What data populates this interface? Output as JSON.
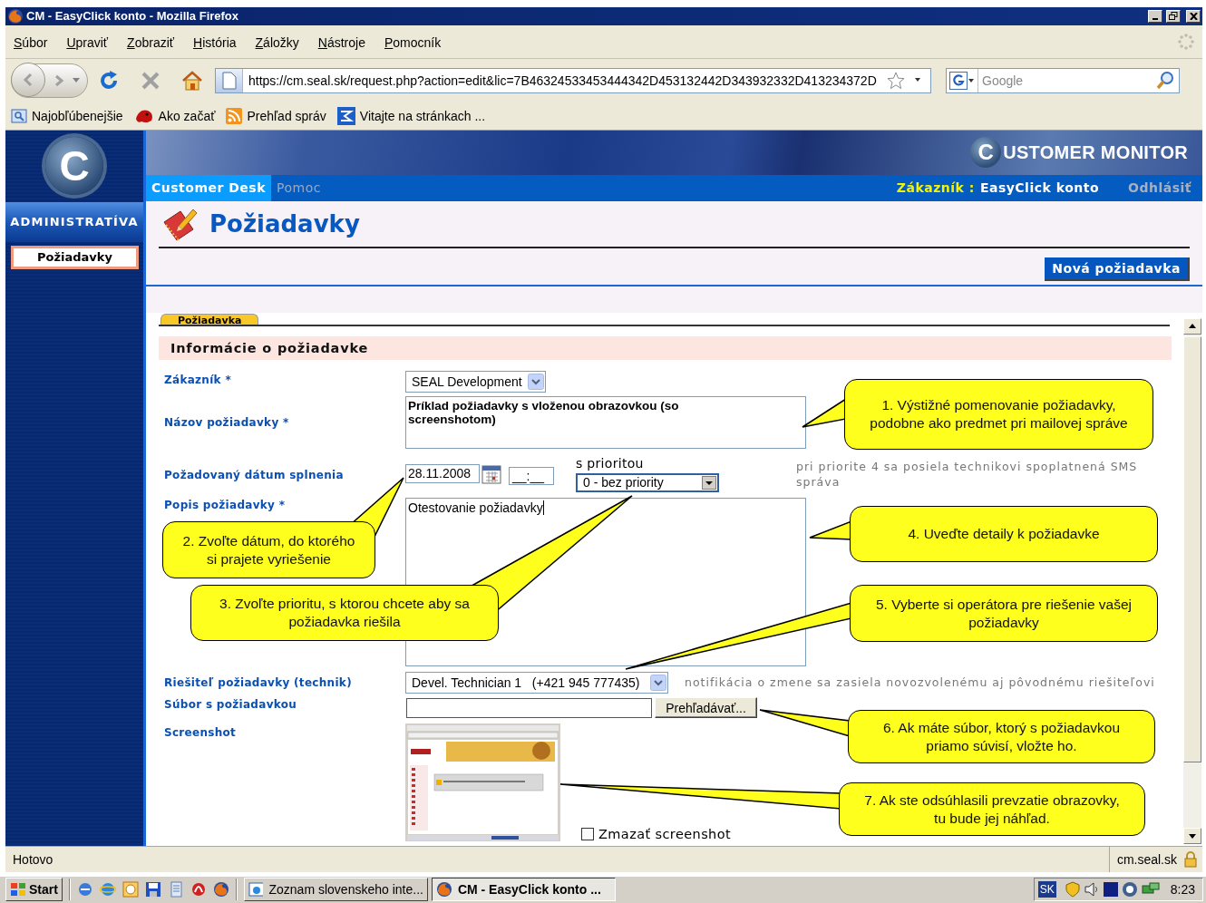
{
  "window": {
    "title": "CM - EasyClick konto - Mozilla Firefox"
  },
  "menu": [
    "Súbor",
    "Upraviť",
    "Zobraziť",
    "História",
    "Záložky",
    "Nástroje",
    "Pomocník"
  ],
  "address_bar": {
    "value": "https://cm.seal.sk/request.php?action=edit&lic=7B46324533453444342D453132442D343932332D413234372D"
  },
  "search_field": {
    "placeholder": "Google"
  },
  "bookmarks": [
    "Najobľúbenejšie",
    "Ako začať",
    "Prehľad správ",
    "Vitajte na stránkach ..."
  ],
  "sidebar": {
    "logo": "C",
    "section": "ADMINISTRATÍVA",
    "items": [
      {
        "label": "Požiadavky",
        "selected": true
      }
    ]
  },
  "banner": {
    "logo_mark": "C",
    "logo_text": "USTOMER MONITOR"
  },
  "nav": {
    "tabs": [
      {
        "label": "Customer Desk",
        "selected": true
      },
      {
        "label": "Pomoc",
        "selected": false
      }
    ],
    "customer_label": "Zákazník :",
    "customer_name": "EasyClick konto",
    "logout": "Odhlásiť"
  },
  "page": {
    "title": "Požiadavky",
    "new_button": "Nová požiadavka"
  },
  "form": {
    "tab": "Požiadavka",
    "section_title": "Informácie o požiadavke",
    "customer": {
      "label": "Zákazník *",
      "value": "SEAL Development"
    },
    "title": {
      "label": "Názov požiadavky *",
      "value": "Príklad požiadavky s vloženou obrazovkou (so screenshotom)"
    },
    "due": {
      "label": "Požadovaný dátum splnenia",
      "date": "28.11.2008",
      "time": "__:__",
      "priority_label": "s prioritou",
      "priority": "0 - bez priority",
      "note": "pri priorite 4 sa posiela technikovi spoplatnená SMS správa"
    },
    "description": {
      "label": "Popis požiadavky *",
      "value": "Otestovanie požiadavky"
    },
    "technician": {
      "label": "Riešiteľ požiadavky (technik)",
      "value": "Devel. Technician 1   (+421 945 777435)",
      "note": "notifikácia o zmene sa zasiela novozvolenému aj pôvodnému riešiteľovi"
    },
    "file": {
      "label": "Súbor s požiadavkou",
      "button": "Prehľadávať..."
    },
    "screenshot": {
      "label": "Screenshot",
      "delete_label": "Zmazať screenshot",
      "delete_checked": false
    }
  },
  "callouts": [
    {
      "text": "1. Výstižné pomenovanie požiadavky, podobne ako predmet pri mailovej správe"
    },
    {
      "text": "2. Zvoľte dátum, do ktorého si prajete vyriešenie"
    },
    {
      "text": "3. Zvoľte prioritu, s ktorou chcete aby sa požiadavka riešila"
    },
    {
      "text": "4. Uveďte detaily k požiadavke"
    },
    {
      "text": "5. Vyberte si operátora pre riešenie vašej požiadavky"
    },
    {
      "text": "6. Ak máte súbor, ktorý s požiadavkou priamo súvisí, vložte ho."
    },
    {
      "text": "7. Ak ste odsúhlasili prevzatie obrazovky, tu bude jej náhľad."
    }
  ],
  "status_bar": {
    "text": "Hotovo",
    "domain": "cm.seal.sk"
  },
  "taskbar": {
    "start": "Start",
    "tasks": [
      {
        "label": "Zoznam slovenskeho inte...",
        "selected": false
      },
      {
        "label": "CM - EasyClick konto ...",
        "selected": true
      }
    ],
    "language": "SK",
    "clock": "8:23"
  }
}
